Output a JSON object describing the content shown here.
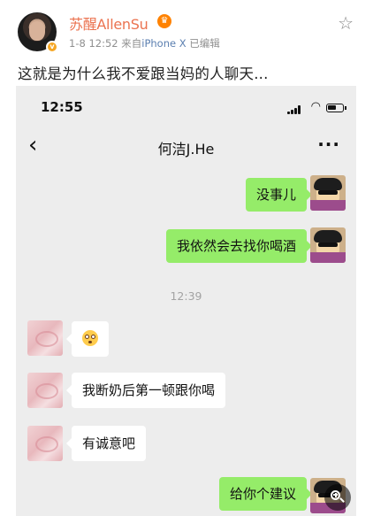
{
  "post": {
    "username": "苏醒AllenSu",
    "date_time": "1-8 12:52",
    "source_prefix": "来自",
    "device": "iPhone X",
    "edited": "已编辑",
    "text": "这就是为什么我不爱跟当妈的人聊天..."
  },
  "chat": {
    "status_time": "12:55",
    "title": "何洁J.He",
    "timestamp": "12:39",
    "messages": [
      {
        "side": "right",
        "text": "没事儿"
      },
      {
        "side": "right",
        "text": "我依然会去找你喝酒"
      },
      {
        "side": "left",
        "emoji": "flushed-face"
      },
      {
        "side": "left",
        "text": "我断奶后第一顿跟你喝"
      },
      {
        "side": "left",
        "text": "有诚意吧"
      },
      {
        "side": "right",
        "text": "给你个建议"
      }
    ]
  },
  "colors": {
    "username": "#eb7350",
    "bubble_self": "#95ec69",
    "bubble_other": "#ffffff",
    "chat_bg": "#ededed"
  },
  "icons": {
    "favorite": "star-outline-icon",
    "back": "chevron-left-icon",
    "more": "more-dots-icon",
    "zoom": "zoom-in-icon"
  }
}
